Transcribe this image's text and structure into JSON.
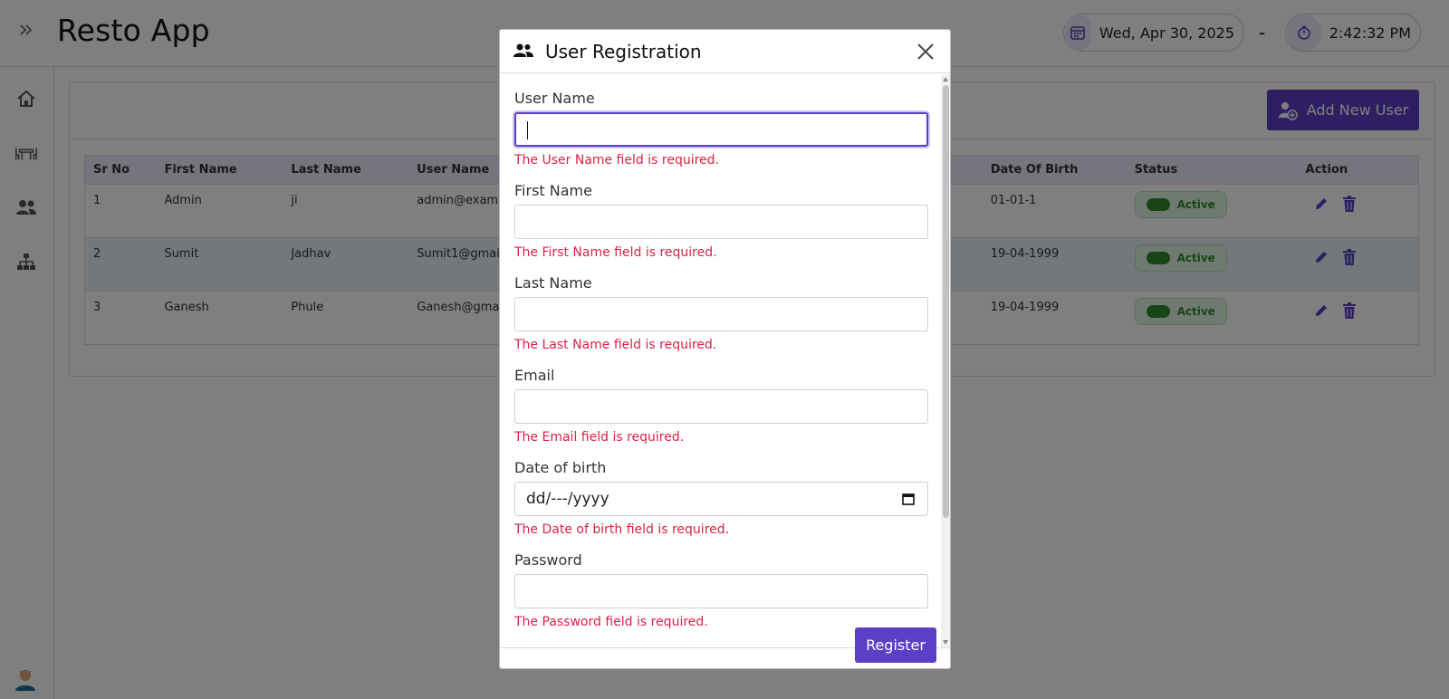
{
  "app": {
    "title": "Resto App"
  },
  "header": {
    "date": "Wed, Apr 30, 2025",
    "separator": "-",
    "time": "2:42:32 PM"
  },
  "sidebar": {
    "items": [
      {
        "icon": "home-icon"
      },
      {
        "icon": "table-icon"
      },
      {
        "icon": "users-icon"
      },
      {
        "icon": "sitemap-icon"
      }
    ]
  },
  "users_page": {
    "add_button": "Add New User",
    "columns": [
      "Sr No",
      "First Name",
      "Last Name",
      "User Name",
      "Date Of Birth",
      "Status",
      "Action"
    ],
    "rows": [
      {
        "sr": "1",
        "first": "Admin",
        "last": "ji",
        "user": "admin@exam",
        "dob": "01-01-1",
        "status": "Active"
      },
      {
        "sr": "2",
        "first": "Sumit",
        "last": "Jadhav",
        "user": "Sumit1@gmail.",
        "dob": "19-04-1999",
        "status": "Active"
      },
      {
        "sr": "3",
        "first": "Ganesh",
        "last": "Phule",
        "user": "Ganesh@gma",
        "dob": "19-04-1999",
        "status": "Active"
      }
    ]
  },
  "modal": {
    "title": "User Registration",
    "fields": [
      {
        "label": "User Name",
        "value": "",
        "error": "The User Name field is required."
      },
      {
        "label": "First Name",
        "value": "",
        "error": "The First Name field is required."
      },
      {
        "label": "Last Name",
        "value": "",
        "error": "The Last Name field is required."
      },
      {
        "label": "Email",
        "value": "",
        "error": "The Email field is required."
      },
      {
        "label": "Date of birth",
        "value": "dd/---/yyyy",
        "error": "The Date of birth field is required."
      },
      {
        "label": "Password",
        "value": "",
        "error": "The Password field is required."
      }
    ],
    "submit_label": "Register"
  },
  "colors": {
    "accent": "#5b3fc4",
    "error": "#dc1f45",
    "active_green": "#2e8a2e",
    "table_header": "#ece8f8"
  }
}
